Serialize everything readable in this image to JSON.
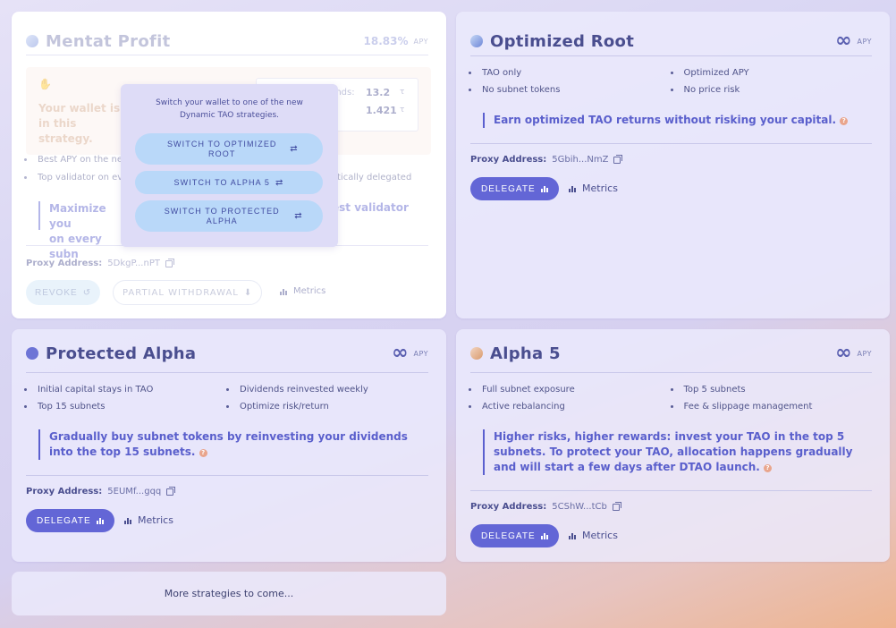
{
  "mentat": {
    "title": "Mentat Profit",
    "apy_value": "18.83%",
    "apy_label": "APY",
    "box_text": "Your wallet is in this strategy.",
    "box_right_label": "unds:",
    "box_value_1": "13.2",
    "box_unit": "τ",
    "box_value_2": "1.421",
    "features": [
      "Best APY on the net",
      "Top validator on eve",
      "",
      "tically delegated"
    ],
    "quote_left": "Maximize you",
    "quote_left2": "on every subn",
    "quote_right": "est validator",
    "proxy_label": "Proxy Address:",
    "proxy_value": "5DkgP...nPT",
    "revoke_label": "REVOKE",
    "partial_label": "PARTIAL WITHDRAWAL",
    "metrics_label": "Metrics"
  },
  "popup": {
    "text": "Switch your wallet to one of the new Dynamic TAO strategies.",
    "buttons": [
      "SWITCH TO OPTIMIZED ROOT",
      "SWITCH TO ALPHA 5",
      "SWITCH TO PROTECTED ALPHA"
    ]
  },
  "optimized": {
    "title": "Optimized Root",
    "apy_label": "APY",
    "features": [
      "TAO only",
      "Optimized APY",
      "No subnet tokens",
      "No price risk"
    ],
    "quote": "Earn optimized TAO returns without risking your capital.",
    "proxy_label": "Proxy Address:",
    "proxy_value": "5Gbih...NmZ",
    "delegate_label": "DELEGATE",
    "metrics_label": "Metrics"
  },
  "protected": {
    "title": "Protected Alpha",
    "apy_label": "APY",
    "features": [
      "Initial capital stays in TAO",
      "Dividends reinvested weekly",
      "Top 15 subnets",
      "Optimize risk/return"
    ],
    "quote": "Gradually buy subnet tokens by reinvesting your dividends into the top 15 subnets.",
    "proxy_label": "Proxy Address:",
    "proxy_value": "5EUMf...gqq",
    "delegate_label": "DELEGATE",
    "metrics_label": "Metrics"
  },
  "alpha5": {
    "title": "Alpha 5",
    "apy_label": "APY",
    "features": [
      "Full subnet exposure",
      "Top 5 subnets",
      "Active rebalancing",
      "Fee & slippage management"
    ],
    "quote": "Higher risks, higher rewards: invest your TAO in the top 5 subnets. To protect your TAO, allocation happens gradually and will start a few days after DTAO launch.",
    "proxy_label": "Proxy Address:",
    "proxy_value": "5CShW...tCb",
    "delegate_label": "DELEGATE",
    "metrics_label": "Metrics"
  },
  "more": "More strategies to come...",
  "colors": {
    "accent": "#6366d6",
    "switch": "#b9d8f9",
    "title": "#4a4e8f"
  }
}
